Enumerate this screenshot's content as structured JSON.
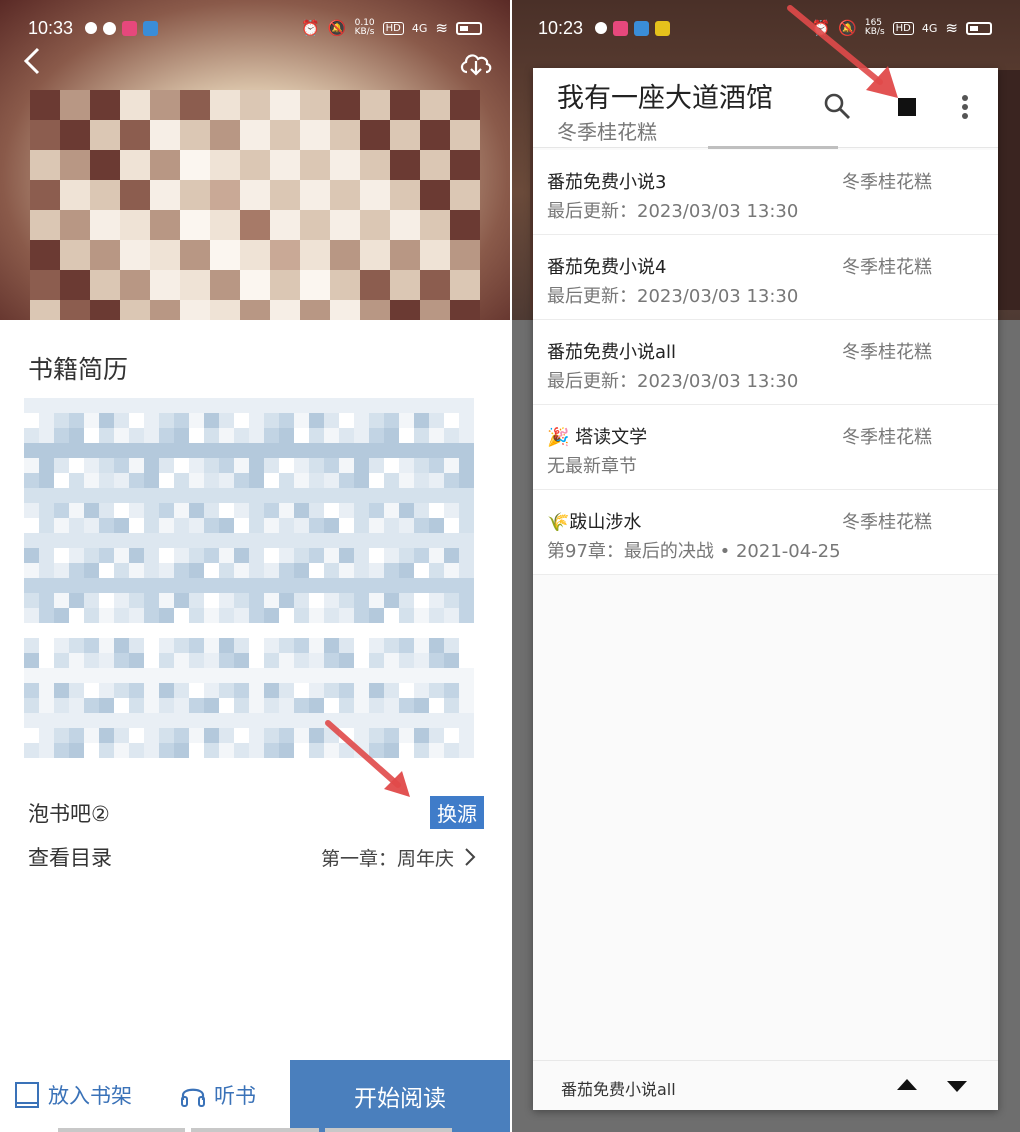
{
  "left": {
    "status": {
      "time": "10:33",
      "net_speed": "0.10\nKB/s",
      "hd": "HD",
      "signal": "4G"
    },
    "intro_title": "书籍简历",
    "source_name": "泡书吧②",
    "swap_label": "换源",
    "toc_label": "查看目录",
    "toc_chapter": "第一章：周年庆",
    "bottom": {
      "shelf_label": "放入书架",
      "listen_label": "听书",
      "start_label": "开始阅读"
    },
    "accent": "#4a7fbd"
  },
  "right": {
    "status": {
      "time": "10:23",
      "net_speed": "165\nKB/s",
      "hd": "HD",
      "signal": "4G"
    },
    "dialog": {
      "title": "我有一座大道酒馆",
      "author": "冬季桂花糕",
      "sources": [
        {
          "name": "番茄免费小说3",
          "author": "冬季桂花糕",
          "sub": "最后更新：2023/03/03 13:30"
        },
        {
          "name": "番茄免费小说4",
          "author": "冬季桂花糕",
          "sub": "最后更新：2023/03/03 13:30"
        },
        {
          "name": "番茄免费小说all",
          "author": "冬季桂花糕",
          "sub": "最后更新：2023/03/03 13:30"
        },
        {
          "name": "🎉 塔读文学",
          "author": "冬季桂花糕",
          "sub": "无最新章节"
        },
        {
          "name": "🌾跋山涉水",
          "author": "冬季桂花糕",
          "sub": "第97章：最后的决战 • 2021-04-25"
        }
      ],
      "footer_text": "番茄免费小说all"
    }
  }
}
